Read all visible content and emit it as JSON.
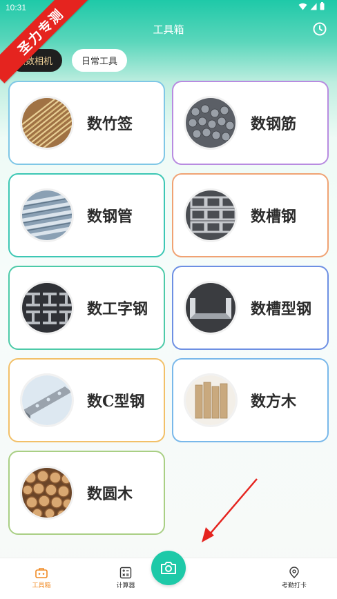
{
  "status": {
    "time": "10:31"
  },
  "promo": {
    "text": "圣力专测"
  },
  "header": {
    "title": "工具箱"
  },
  "tabs": [
    {
      "label": "点数相机",
      "active": true
    },
    {
      "label": "日常工具",
      "active": false
    }
  ],
  "tools": [
    {
      "label": "数竹签",
      "border": "#7fc7e6",
      "thumb": "bamboo"
    },
    {
      "label": "数钢筋",
      "border": "#b88be0",
      "thumb": "rebar"
    },
    {
      "label": "数钢管",
      "border": "#3cc7b4",
      "thumb": "pipe"
    },
    {
      "label": "数槽钢",
      "border": "#f0a273",
      "thumb": "channel"
    },
    {
      "label": "数工字钢",
      "border": "#4ccaa8",
      "thumb": "ibeam"
    },
    {
      "label": "数槽型钢",
      "border": "#6d8fe3",
      "thumb": "uchannel"
    },
    {
      "label": "数C型钢",
      "border": "#f2c068",
      "thumb": "cchannel"
    },
    {
      "label": "数方木",
      "border": "#79b8ea",
      "thumb": "timber"
    },
    {
      "label": "数圆木",
      "border": "#a9cf84",
      "thumb": "logs"
    }
  ],
  "bottom_nav": {
    "toolbox": "工具箱",
    "calculator": "计算器",
    "checkin": "考勤打卡"
  },
  "colors": {
    "accent": "#1ec9a8",
    "active_nav": "#f08a23",
    "promo": "#e5241f"
  }
}
